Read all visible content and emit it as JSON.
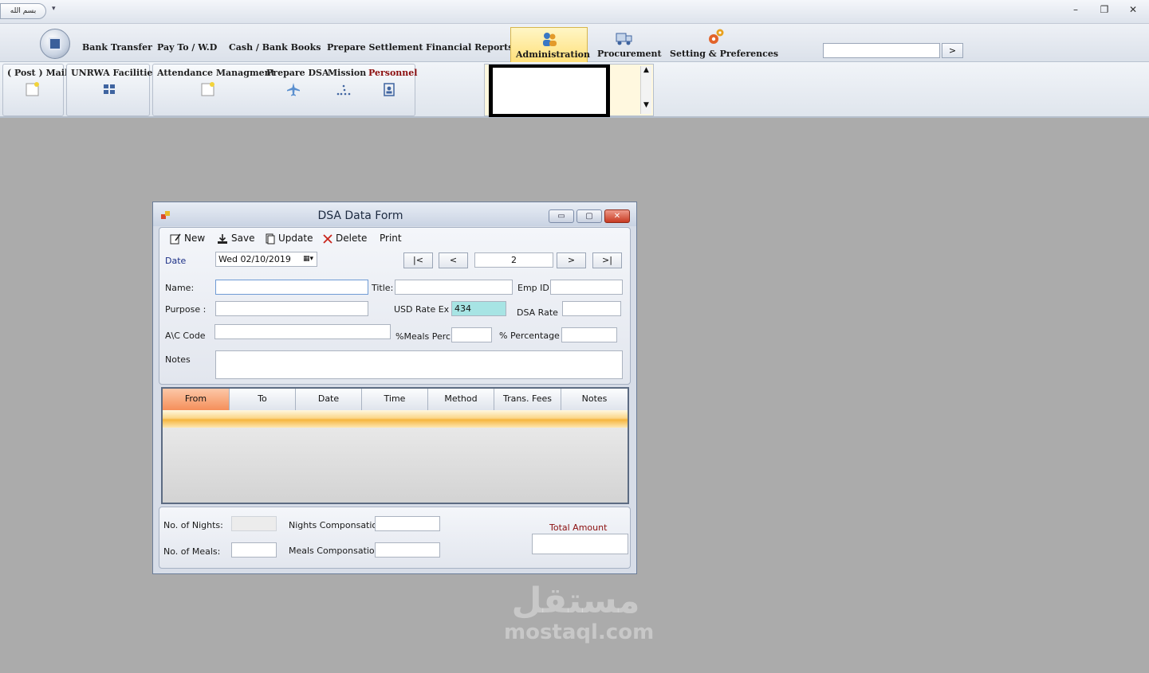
{
  "titlebar": {
    "qa_label": "بسم الله",
    "qa_arrow": "▾",
    "minimize": "–",
    "restore": "❐",
    "close": "✕"
  },
  "ribbon": {
    "tabs": [
      {
        "label": "Bank Transfer"
      },
      {
        "label": "Pay To / W.D"
      },
      {
        "label": "Cash  / Bank Books"
      },
      {
        "label": "Prepare Settlement"
      },
      {
        "label": "Financial Reports"
      },
      {
        "label": "Administration"
      },
      {
        "label": "Procurement"
      },
      {
        "label": "Setting & Preferences"
      }
    ],
    "active_tab": "Administration",
    "search_value": "",
    "search_button": ">"
  },
  "groups": {
    "post_mail": "( Post ) Mail",
    "unrwa": "UNRWA Facilities",
    "attendance": "Attendance Managment",
    "prepare_dsa": "Prepare DSA",
    "mission": "Mission",
    "personnel": "Personnel",
    "scroll_up": "▲",
    "scroll_down": "▼"
  },
  "form": {
    "title": "DSA Data Form",
    "controls": {
      "minimize": "▭",
      "restore": "▢",
      "close": "✕"
    },
    "toolbar": {
      "new": "New",
      "save": "Save",
      "update": "Update",
      "delete": "Delete",
      "print": "Print"
    },
    "date_label": "Date",
    "date_value": "Wed 02/10/2019",
    "nav": {
      "first": "|<",
      "prev": "<",
      "record": "2",
      "next": ">",
      "last": ">|"
    },
    "fields": {
      "name_label": "Name:",
      "name_value": "",
      "title_label": "Title:",
      "title_value": "",
      "empid_label": "Emp ID:",
      "empid_value": "",
      "purpose_label": "Purpose :",
      "purpose_value": "",
      "usd_label": "USD Rate Ex",
      "usd_value": "434",
      "dsa_rate_label": "DSA Rate",
      "dsa_rate_value": "",
      "ac_label": "A\\C Code",
      "ac_value": "",
      "meals_perc_label": "%Meals Perc.",
      "meals_perc_value": "",
      "percentage_label": "% Percentage",
      "percentage_value": "",
      "notes_label": "Notes",
      "notes_value": ""
    },
    "grid": {
      "columns": [
        "From",
        "To",
        "Date",
        "Time",
        "Method",
        "Trans. Fees",
        "Notes"
      ]
    },
    "footer": {
      "nights_label": "No. of Nights:",
      "nights_value": "",
      "meals_label": "No. of Meals:",
      "meals_value": "",
      "nights_comp_label": "Nights Componsation",
      "nights_comp_value": "",
      "meals_comp_label": "Meals Componsation",
      "meals_comp_value": "",
      "total_label": "Total Amount",
      "total_value": ""
    }
  },
  "watermark": {
    "arabic": "مستقل",
    "latin": "mostaql.com"
  },
  "colors": {
    "accent_active_tab": "#ffe07a",
    "grid_header_selected": "#f58f5a",
    "usd_field": "#a7e4e4",
    "total_label": "#8b0e0e"
  }
}
